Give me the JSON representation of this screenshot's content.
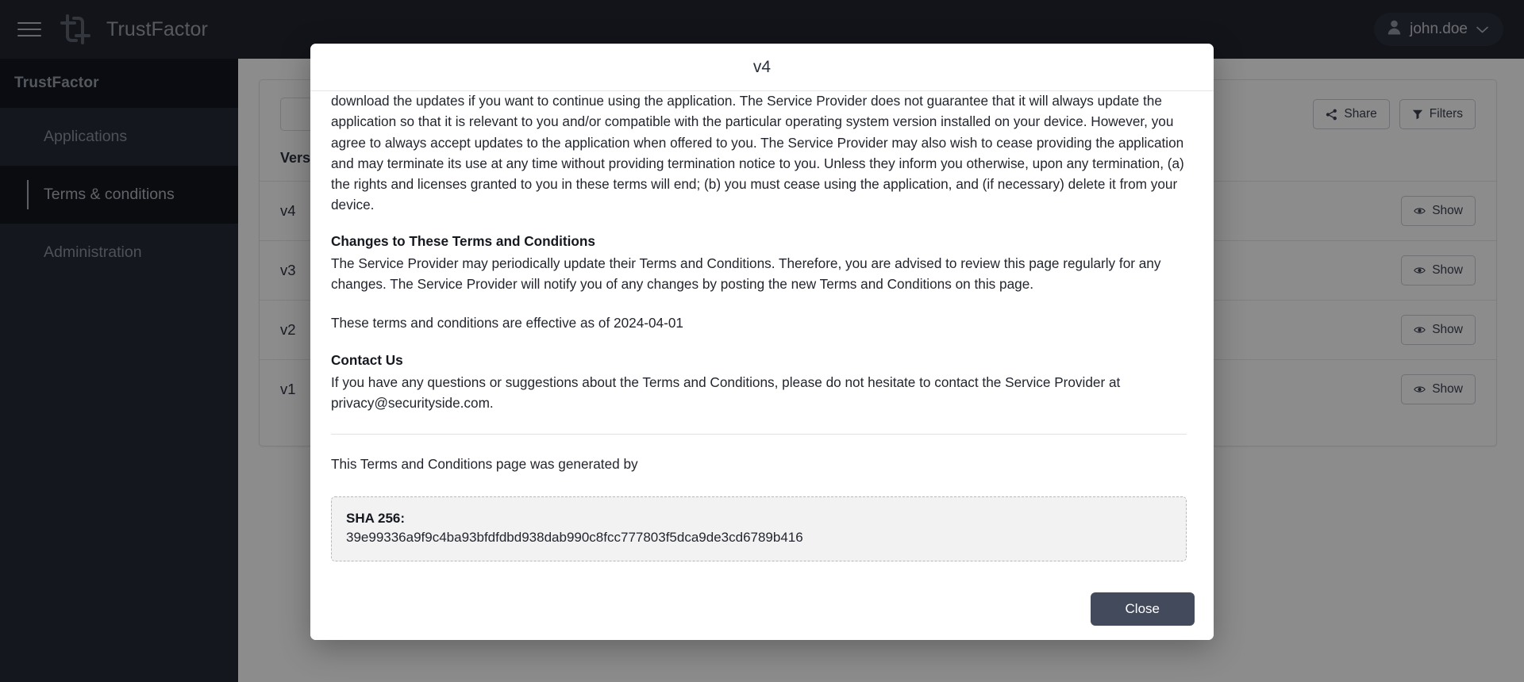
{
  "topbar": {
    "menu_icon": "hamburger-icon",
    "logo_icon": "trustfactor-logo",
    "brand": "TrustFactor",
    "user": {
      "avatar_icon": "person-icon",
      "name": "john.doe",
      "chevron_icon": "chevron-down-icon"
    }
  },
  "sidebar": {
    "title": "TrustFactor",
    "items": [
      {
        "label": "Applications",
        "active": false
      },
      {
        "label": "Terms & conditions",
        "active": true
      },
      {
        "label": "Administration",
        "active": false
      }
    ]
  },
  "main": {
    "toolbar": {
      "search_placeholder": "",
      "share_label": "Share",
      "share_icon": "share-icon",
      "filters_label": "Filters",
      "filters_icon": "funnel-icon"
    },
    "table": {
      "columns": [
        "Version",
        ""
      ],
      "rows": [
        {
          "version": "v4",
          "action_label": "Show",
          "action_icon": "eye-icon"
        },
        {
          "version": "v3",
          "action_label": "Show",
          "action_icon": "eye-icon"
        },
        {
          "version": "v2",
          "action_label": "Show",
          "action_icon": "eye-icon"
        },
        {
          "version": "v1",
          "action_label": "Show",
          "action_icon": "eye-icon"
        }
      ]
    }
  },
  "modal": {
    "title": "v4",
    "paragraph_1": "The Service Provider may wish to update the application at some point. The application is currently available as per the requirements for the operating system (and for any additional systems they decide to extend the availability of the application to) may change, and you will need to download the updates if you want to continue using the application. The Service Provider does not guarantee that it will always update the application so that it is relevant to you and/or compatible with the particular operating system version installed on your device. However, you agree to always accept updates to the application when offered to you. The Service Provider may also wish to cease providing the application and may terminate its use at any time without providing termination notice to you. Unless they inform you otherwise, upon any termination, (a) the rights and licenses granted to you in these terms will end; (b) you must cease using the application, and (if necessary) delete it from your device.",
    "heading_changes": "Changes to These Terms and Conditions",
    "paragraph_changes": "The Service Provider may periodically update their Terms and Conditions. Therefore, you are advised to review this page regularly for any changes. The Service Provider will notify you of any changes by posting the new Terms and Conditions on this page.",
    "effective_date_line": "These terms and conditions are effective as of 2024-04-01",
    "heading_contact": "Contact Us",
    "paragraph_contact": "If you have any questions or suggestions about the Terms and Conditions, please do not hesitate to contact the Service Provider at privacy@securityside.com.",
    "generated_by_line": "This Terms and Conditions page was generated by",
    "sha_label": "SHA 256:",
    "sha_value": "39e99336a9f9c4ba93bfdfdbd938dab990c8fcc777803f5dca9de3cd6789b416",
    "close_label": "Close"
  },
  "colors": {
    "topbar_bg": "#212530",
    "sidebar_bg": "#252a36",
    "sidebar_active_bg": "#13161d",
    "close_button_bg": "#434a5c",
    "overlay": "rgba(0,0,0,0.45)"
  }
}
